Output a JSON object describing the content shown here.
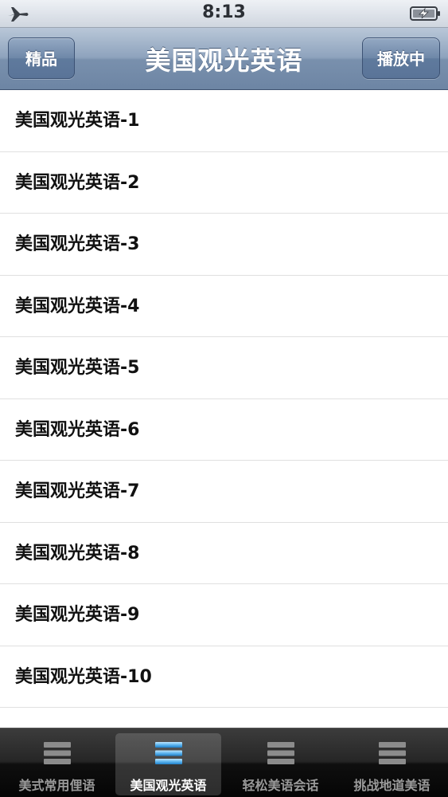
{
  "status_bar": {
    "time": "8:13",
    "left_icon": "airplane-icon",
    "right_icon": "battery-charging-icon"
  },
  "nav_bar": {
    "title": "美国观光英语",
    "left_button": "精品",
    "right_button": "播放中"
  },
  "list": {
    "items": [
      {
        "label": "美国观光英语-1"
      },
      {
        "label": "美国观光英语-2"
      },
      {
        "label": "美国观光英语-3"
      },
      {
        "label": "美国观光英语-4"
      },
      {
        "label": "美国观光英语-5"
      },
      {
        "label": "美国观光英语-6"
      },
      {
        "label": "美国观光英语-7"
      },
      {
        "label": "美国观光英语-8"
      },
      {
        "label": "美国观光英语-9"
      },
      {
        "label": "美国观光英语-10"
      }
    ]
  },
  "tab_bar": {
    "active_index": 1,
    "tabs": [
      {
        "label": "美式常用俚语",
        "icon": "list-icon"
      },
      {
        "label": "美国观光英语",
        "icon": "list-icon"
      },
      {
        "label": "轻松美语会话",
        "icon": "list-icon"
      },
      {
        "label": "挑战地道美语",
        "icon": "list-icon"
      }
    ]
  },
  "colors": {
    "nav_gradient_top": "#b9c7d8",
    "nav_gradient_bottom": "#6d85a4",
    "active_tab_icon": "#5fb6ef",
    "inactive_tab_icon": "#8c8c8c"
  }
}
